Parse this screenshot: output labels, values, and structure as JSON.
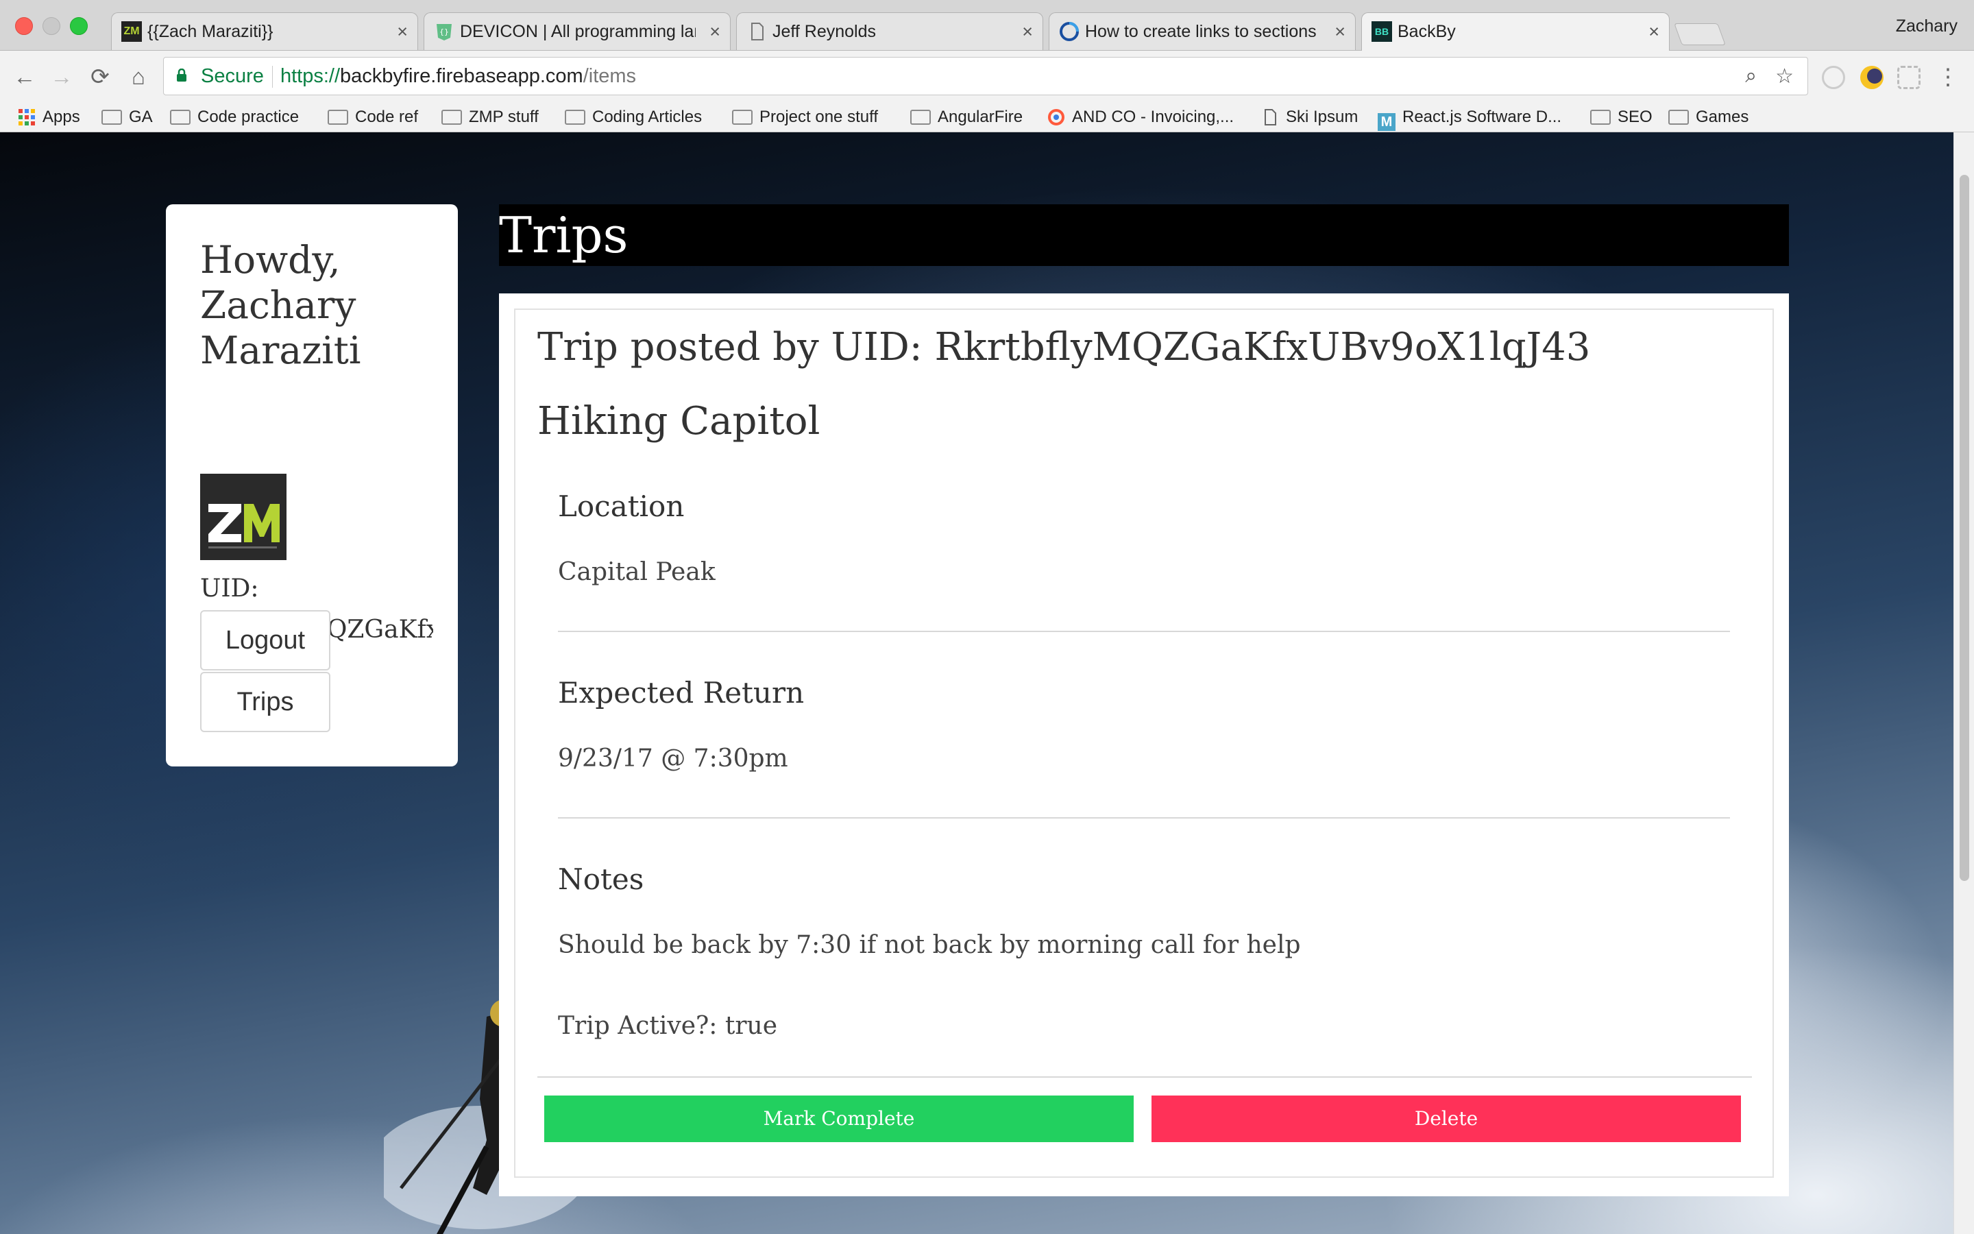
{
  "browser": {
    "tabs": [
      {
        "title": "{{Zach Maraziti}}",
        "favicon": "zm-logo-icon"
      },
      {
        "title": "DEVICON | All programming languages",
        "favicon": "devicon-icon"
      },
      {
        "title": "Jeff Reynolds",
        "favicon": "page-icon"
      },
      {
        "title": "How to create links to sections",
        "favicon": "site-icon"
      },
      {
        "title": "BackBy",
        "favicon": "backby-icon"
      }
    ],
    "profile_name": "Zachary",
    "close_glyph": "×",
    "nav": {
      "back": "←",
      "forward": "→",
      "reload": "⟳",
      "home": "⌂",
      "menu": "⋮",
      "zoom": "⌕",
      "star": "☆"
    },
    "secure_label": "Secure",
    "url": {
      "scheme": "https://",
      "host": "backbyfire.firebaseapp.com",
      "path": "/items"
    },
    "bookmarks": [
      {
        "label": "Apps",
        "icon": "apps-grid-icon"
      },
      {
        "label": "GA",
        "icon": "folder-icon"
      },
      {
        "label": "Code practice",
        "icon": "folder-icon"
      },
      {
        "label": "Code ref",
        "icon": "folder-icon"
      },
      {
        "label": "ZMP stuff",
        "icon": "folder-icon"
      },
      {
        "label": "Coding Articles",
        "icon": "folder-icon"
      },
      {
        "label": "Project one stuff",
        "icon": "folder-icon"
      },
      {
        "label": "AngularFire",
        "icon": "folder-icon"
      },
      {
        "label": "AND CO - Invoicing,...",
        "icon": "andco-icon"
      },
      {
        "label": "Ski Ipsum",
        "icon": "page-icon"
      },
      {
        "label": "React.js Software D...",
        "icon": "m-icon"
      },
      {
        "label": "SEO",
        "icon": "folder-icon"
      },
      {
        "label": "Games",
        "icon": "folder-icon"
      }
    ]
  },
  "sidebar": {
    "greeting": "Howdy, Zachary Maraziti",
    "avatar_text": "ZM",
    "uid_label": "UID:",
    "uid_value": "RkrtbflyMQZGaKfxU",
    "logout_label": "Logout",
    "trips_label": "Trips"
  },
  "main": {
    "page_title": "Trips",
    "trip": {
      "poster": "Trip posted by UID: RkrtbflyMQZGaKfxUBv9oX1lqJ43",
      "name": "Hiking Capitol",
      "location_title": "Location",
      "location_value": "Capital Peak",
      "return_title": "Expected Return",
      "return_value": "9/23/17 @ 7:30pm",
      "notes_title": "Notes",
      "notes_value": "Should be back by 7:30 if not back by morning call for help",
      "active_text": "Trip Active?: true",
      "complete_label": "Mark Complete",
      "delete_label": "Delete"
    }
  },
  "colors": {
    "complete": "#22d05f",
    "delete": "#ff3158",
    "secure_green": "#0b8043",
    "avatar_accent": "#b5d334"
  }
}
